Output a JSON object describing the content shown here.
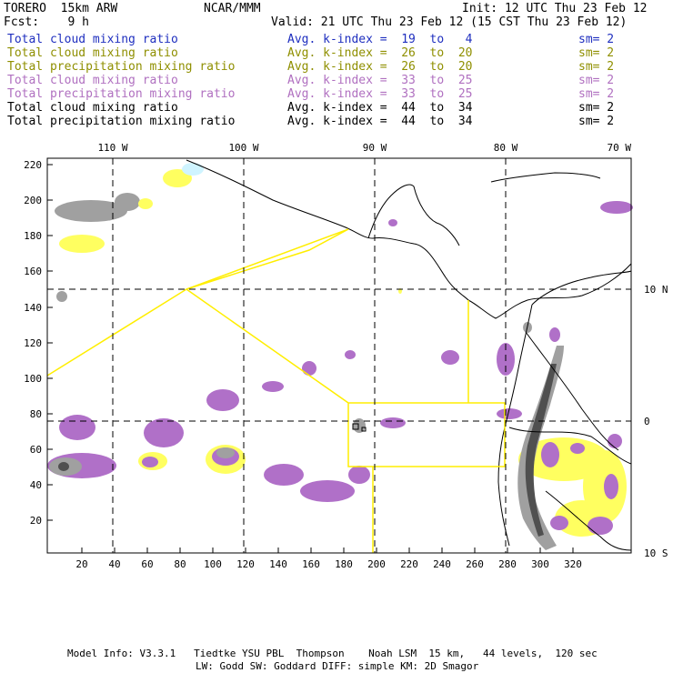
{
  "header": {
    "model": "TORERO  15km ARW",
    "org": "NCAR/MMM",
    "init": "Init: 12 UTC Thu 23 Feb 12",
    "fcst": "Fcst:    9 h",
    "valid": "Valid: 21 UTC Thu 23 Feb 12 (15 CST Thu 23 Feb 12)"
  },
  "legend": [
    {
      "field": "Total cloud mixing ratio",
      "kindex": "Avg. k-index =  19  to   4",
      "sm": "sm= 2",
      "color": "#1f2fbf"
    },
    {
      "field": "Total cloud mixing ratio",
      "kindex": "Avg. k-index =  26  to  20",
      "sm": "sm= 2",
      "color": "#8f8f00"
    },
    {
      "field": "Total precipitation mixing ratio",
      "kindex": "Avg. k-index =  26  to  20",
      "sm": "sm= 2",
      "color": "#8f8f00"
    },
    {
      "field": "Total cloud mixing ratio",
      "kindex": "Avg. k-index =  33  to  25",
      "sm": "sm= 2",
      "color": "#b070c0"
    },
    {
      "field": "Total precipitation mixing ratio",
      "kindex": "Avg. k-index =  33  to  25",
      "sm": "sm= 2",
      "color": "#b070c0"
    },
    {
      "field": "Total cloud mixing ratio",
      "kindex": "Avg. k-index =  44  to  34",
      "sm": "sm= 2",
      "color": "#000000"
    },
    {
      "field": "Total precipitation mixing ratio",
      "kindex": "Avg. k-index =  44  to  34",
      "sm": "sm= 2",
      "color": "#000000"
    }
  ],
  "axes": {
    "top_lon_labels": [
      "110 W",
      "100 W",
      "90 W",
      "80 W",
      "70 W"
    ],
    "right_lat_labels": [
      "10 N",
      "0",
      "10 S"
    ],
    "left_ticks": [
      "220",
      "200",
      "180",
      "160",
      "140",
      "120",
      "100",
      "80",
      "60",
      "40",
      "20"
    ],
    "bottom_ticks": [
      "20",
      "40",
      "60",
      "80",
      "100",
      "120",
      "140",
      "160",
      "180",
      "200",
      "220",
      "240",
      "260",
      "280",
      "300",
      "320"
    ]
  },
  "colors": {
    "yellow": "#ffff60",
    "purple": "#b070c8",
    "gray": "#a0a0a0",
    "dark": "#505050",
    "cyan": "#cff4ff",
    "domain_lines": "#ffee00"
  },
  "footer": {
    "line1": "Model Info: V3.3.1   Tiedtke YSU PBL  Thompson    Noah LSM  15 km,   44 levels,  120 sec",
    "line2": "LW: Godd SW: Goddard DIFF: simple KM: 2D Smagor"
  }
}
